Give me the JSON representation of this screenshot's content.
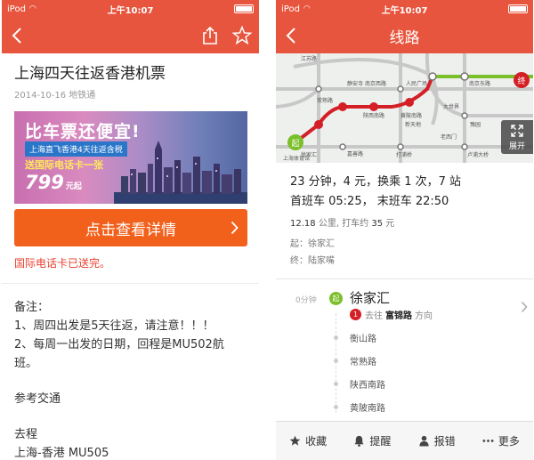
{
  "status_bar": {
    "carrier": "iPod",
    "time": "上午10:07"
  },
  "left_screen": {
    "article_title": "上海四天往返香港机票",
    "meta": "2014-10-16 地铁通",
    "banner": {
      "title": "比车票还便宜!",
      "subtitle": "上海直飞香港4天往返含税",
      "gift": "送国际电话卡一张",
      "price": "799",
      "price_suffix": "元起"
    },
    "cta_label": "点击查看详情",
    "sent_notice": "国际电话卡已送完。",
    "notes": {
      "label": "备注：",
      "item1": "1、周四出发是5天往返，请注意！！！",
      "item2a": "2、每周一出发的日期，回程是MU502航",
      "item2b": "班。",
      "transport_label": "参考交通",
      "outbound_label": "去程",
      "outbound_flight": "上海-香港 MU505"
    }
  },
  "right_screen": {
    "title": "线路",
    "map": {
      "expand_label": "展开",
      "start_marker": "起",
      "end_marker": "终",
      "labels": [
        "江苏路",
        "静安寺",
        "南京西路",
        "人民广场",
        "南京东路",
        "常熟路",
        "陕西南路",
        "黄陂南路",
        "大世界",
        "豫园",
        "新天地",
        "老西门",
        "徐家汇",
        "上海体育馆",
        "嘉善路",
        "打浦桥",
        "卢浦大桥"
      ]
    },
    "summary": {
      "line1": "23 分钟，4 元，换乘 1 次，7 站",
      "line2": "首班车 05:25，  末班车 22:50",
      "distance": "12.18",
      "distance_unit": "公里",
      "taxi_label": "打车约",
      "taxi_fare": "35",
      "taxi_unit": "元",
      "origin": "起：徐家汇",
      "destination": "终：陆家嘴"
    },
    "steps": {
      "duration": "0分钟",
      "start_badge": "起",
      "start_station": "徐家汇",
      "line_number": "1",
      "direction_prefix": "去往",
      "direction_dest": "富锦路",
      "direction_suffix": "方向",
      "stops": [
        "衡山路",
        "常熟路",
        "陕西南路",
        "黄陂南路"
      ]
    },
    "tabbar": {
      "favorite": "收藏",
      "remind": "提醒",
      "report": "报错",
      "more": "更多"
    }
  },
  "colors": {
    "header": "#e8553e",
    "cta": "#f2611c",
    "line1_red": "#d41f26",
    "start_green": "#7bbf2a",
    "notice_red": "#e8402f"
  }
}
